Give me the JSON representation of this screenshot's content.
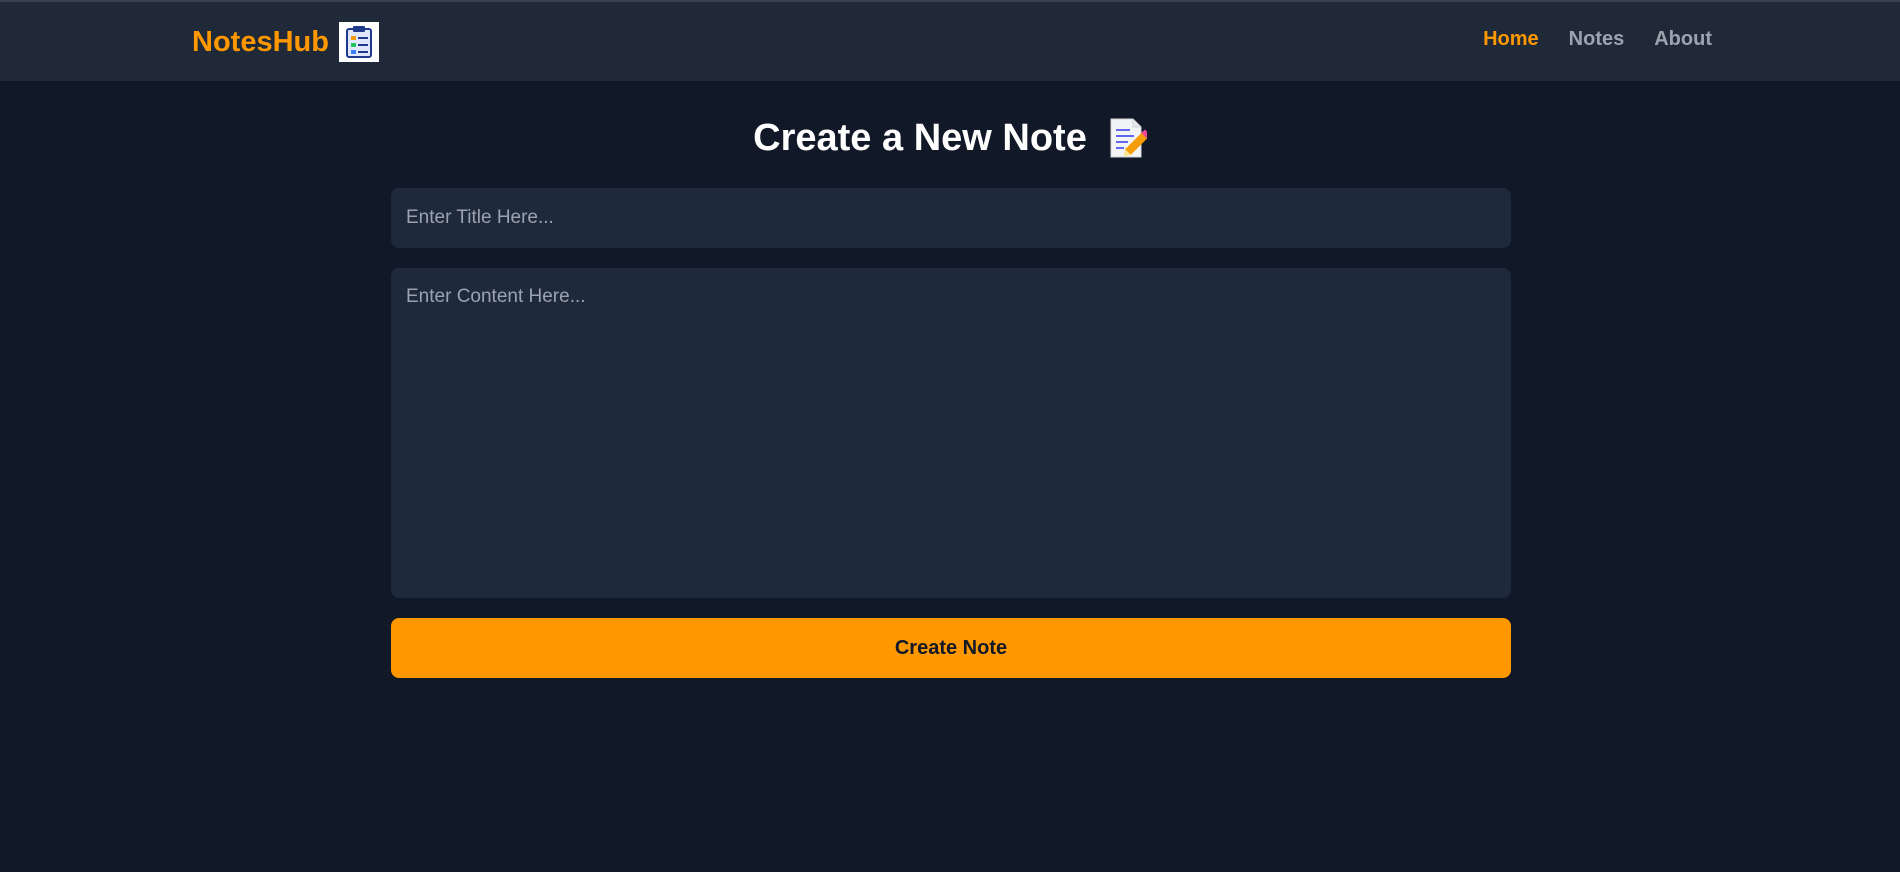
{
  "navbar": {
    "brand": "NotesHub",
    "brand_logo_icon": "clipboard-notes-icon",
    "links": [
      {
        "label": "Home",
        "active": true
      },
      {
        "label": "Notes",
        "active": false
      },
      {
        "label": "About",
        "active": false
      }
    ]
  },
  "main": {
    "heading": "Create a New Note",
    "heading_icon": "memo-pencil-icon",
    "title_input": {
      "placeholder": "Enter Title Here...",
      "value": ""
    },
    "content_input": {
      "placeholder": "Enter Content Here...",
      "value": ""
    },
    "create_button_label": "Create Note"
  },
  "colors": {
    "accent": "#ff9800",
    "background": "#111827",
    "navbar": "#1f2937",
    "input_background": "#1e293b",
    "muted_text": "#9ca3af"
  }
}
